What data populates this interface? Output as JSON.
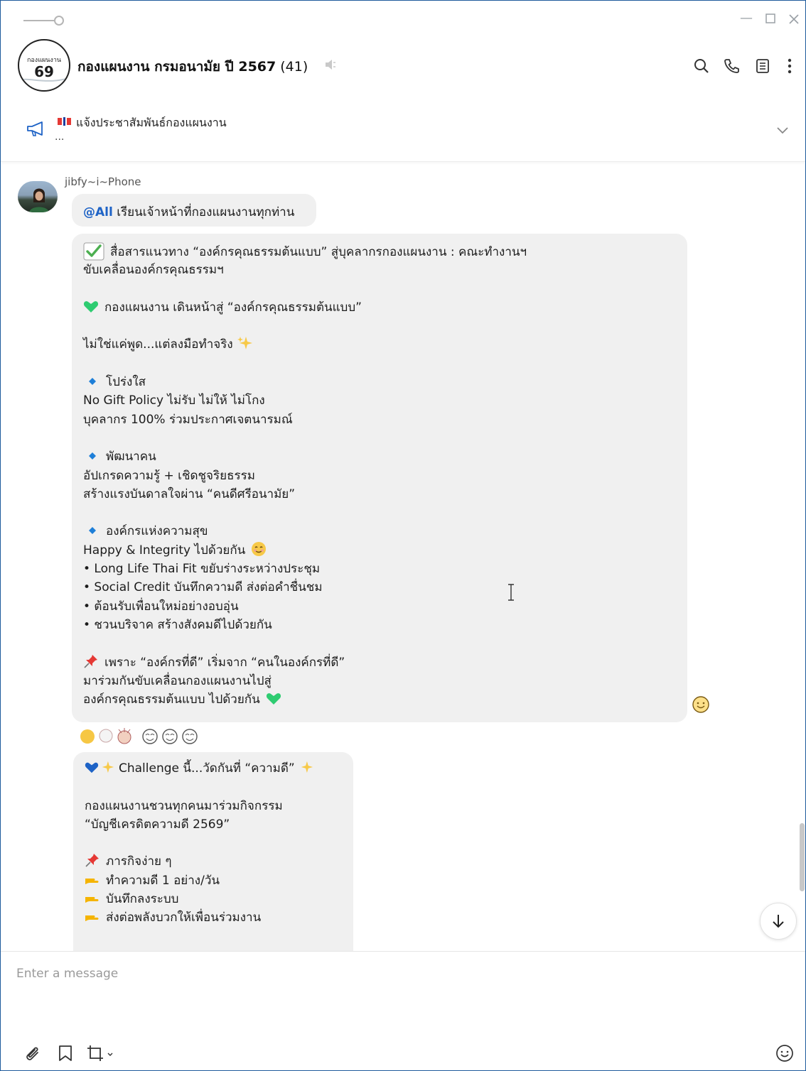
{
  "window": {
    "controls": [
      "minimize",
      "maximize",
      "close"
    ]
  },
  "header": {
    "group_avatar_small": "กองแผนงาน",
    "group_avatar_big": "69",
    "title": "กองแผนงาน กรมอนามัย ปี 2567",
    "member_count": "(41)",
    "icons": [
      "search-icon",
      "call-icon",
      "notes-icon",
      "more-icon"
    ]
  },
  "announcement": {
    "text": "แจ้งประชาสัมพันธ์กองแผนงาน",
    "more": "..."
  },
  "messages": {
    "sender": "jibfy~i~Phone",
    "msg1": {
      "mention": "@All",
      "text": " เรียนเจ้าหน้าที่กองแผนงานทุกท่าน"
    },
    "msg2": {
      "lines": [
        "สื่อสารแนวทาง “องค์กรคุณธรรมต้นแบบ” สู่บุคลากรกองแผนงาน : คณะทำงานฯ",
        "ขับเคลื่อนองค์กรคุณธรรมฯ",
        "",
        "กองแผนงาน เดินหน้าสู่ “องค์กรคุณธรรมต้นแบบ”",
        "",
        "ไม่ใช่แค่พูด...แต่ลงมือทำจริง",
        "",
        "โปร่งใส",
        "No Gift Policy ไม่รับ ไม่ให้ ไม่โกง",
        "บุคลากร 100% ร่วมประกาศเจตนารมณ์",
        "",
        "พัฒนาคน",
        "อัปเกรดความรู้ + เชิดชูจริยธรรม",
        "สร้างแรงบันดาลใจผ่าน “คนดีศรีอนามัย”",
        "",
        "องค์กรแห่งความสุข",
        "Happy & Integrity ไปด้วยกัน",
        "• Long Life Thai Fit ขยับร่างระหว่างประชุม",
        "• Social Credit บันทึกความดี ส่งต่อคำชื่นชม",
        "• ต้อนรับเพื่อนใหม่อย่างอบอุ่น",
        "• ชวนบริจาค สร้างสังคมดีไปด้วยกัน",
        "",
        "เพราะ “องค์กรที่ดี” เริ่มจาก “คนในองค์กรที่ดี”",
        "มาร่วมกันขับเคลื่อนกองแผนงานไปสู่",
        "องค์กรคุณธรรมต้นแบบ ไปด้วยกัน"
      ]
    },
    "msg3": {
      "lines": [
        "Challenge นี้...วัดกันที่ “ความดี”",
        "",
        "กองแผนงานชวนทุกคนมาร่วมกิจกรรม",
        "“บัญชีเครดิตความดี 2569”",
        "",
        "ภารกิจง่าย ๆ",
        "ทำความดี 1 อย่าง/วัน",
        "บันทึกลงระบบ",
        "ส่งต่อพลังบวกให้เพื่อนร่วมงาน"
      ]
    }
  },
  "composer": {
    "placeholder": "Enter a message",
    "icons": [
      "attach-icon",
      "bookmark-icon",
      "crop-icon",
      "emoji-icon"
    ]
  },
  "colors": {
    "window_border": "#1e5b9c",
    "bubble_bg": "#f0f0f0",
    "mention": "#1e63c6",
    "check_green": "#4caf50",
    "heart_green": "#2ecc71",
    "heart_blue": "#1e63c6",
    "diamond_blue": "#1e7fd8",
    "pin_red": "#e53935",
    "point_orange": "#f5b400"
  }
}
